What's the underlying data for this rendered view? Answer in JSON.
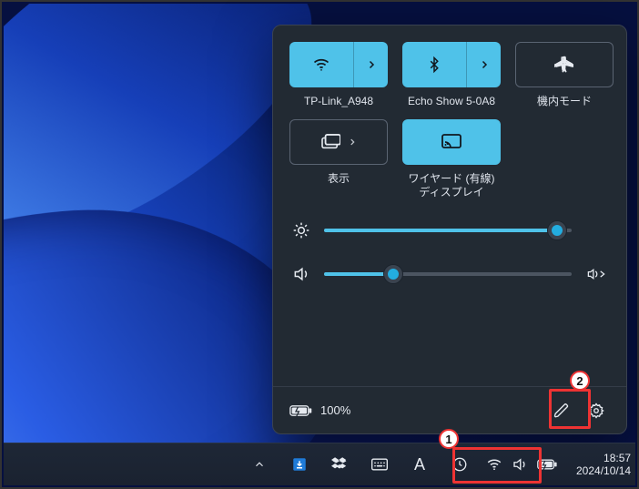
{
  "panel": {
    "tiles": [
      {
        "id": "wifi",
        "label": "TP-Link_A948",
        "state": "on",
        "layout": "split"
      },
      {
        "id": "bluetooth",
        "label": "Echo Show 5-0A8",
        "state": "on",
        "layout": "split"
      },
      {
        "id": "airplane",
        "label": "機内モード",
        "state": "off",
        "layout": "single"
      },
      {
        "id": "project",
        "label": "表示",
        "state": "off",
        "layout": "inline-arrow"
      },
      {
        "id": "cast",
        "label": "ワイヤード (有線)\nディスプレイ",
        "state": "on",
        "layout": "single"
      }
    ],
    "brightness_percent": 94,
    "volume_percent": 28,
    "battery_text": "100%"
  },
  "taskbar": {
    "clock_time": "18:57",
    "clock_date": "2024/10/14"
  },
  "annotations": {
    "badge1": "1",
    "badge2": "2"
  }
}
